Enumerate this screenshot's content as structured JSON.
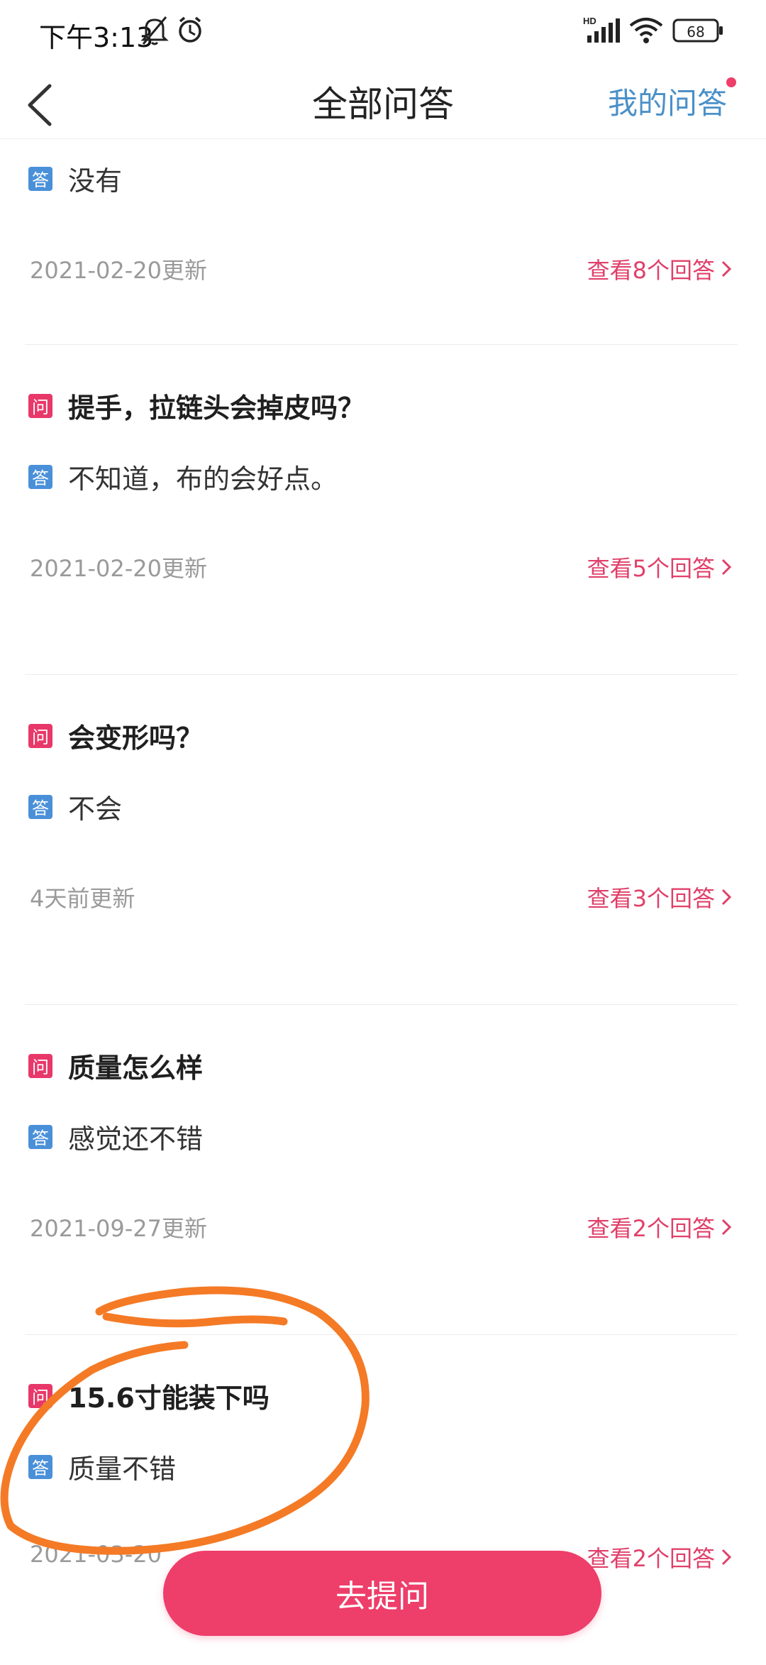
{
  "status_bar": {
    "time": "下午3:13",
    "battery": "68",
    "icons": [
      "mute-bell-icon",
      "alarm-icon",
      "hd-signal-icon",
      "wifi-icon",
      "battery-icon"
    ]
  },
  "header": {
    "back_icon": "back-chevron-icon",
    "title": "全部问答",
    "my_qa_label": "我的问答",
    "badge_color": "#ee3e6a"
  },
  "qa_items": [
    {
      "question": "",
      "answer": "没有",
      "date": "2021-02-20更新",
      "view_label": "查看8个回答"
    },
    {
      "question": "提手，拉链头会掉皮吗？",
      "answer": "不知道，布的会好点。",
      "date": "2021-02-20更新",
      "view_label": "查看5个回答"
    },
    {
      "question": "会变形吗？",
      "answer": "不会",
      "date": "4天前更新",
      "view_label": "查看3个回答"
    },
    {
      "question": "质量怎么样",
      "answer": "感觉还不错",
      "date": "2021-09-27更新",
      "view_label": "查看2个回答"
    },
    {
      "question": "15.6寸能装下吗",
      "answer": "质量不错",
      "date": "2021-03-20",
      "view_label": "查看2个回答"
    }
  ],
  "tags": {
    "question": "问",
    "answer": "答"
  },
  "ask_button": {
    "label": "去提问"
  },
  "colors": {
    "accent": "#ee3e6a",
    "answer_tag": "#4a90d9",
    "link_blue": "#4a90c8",
    "annotation_orange": "#f47a26"
  }
}
